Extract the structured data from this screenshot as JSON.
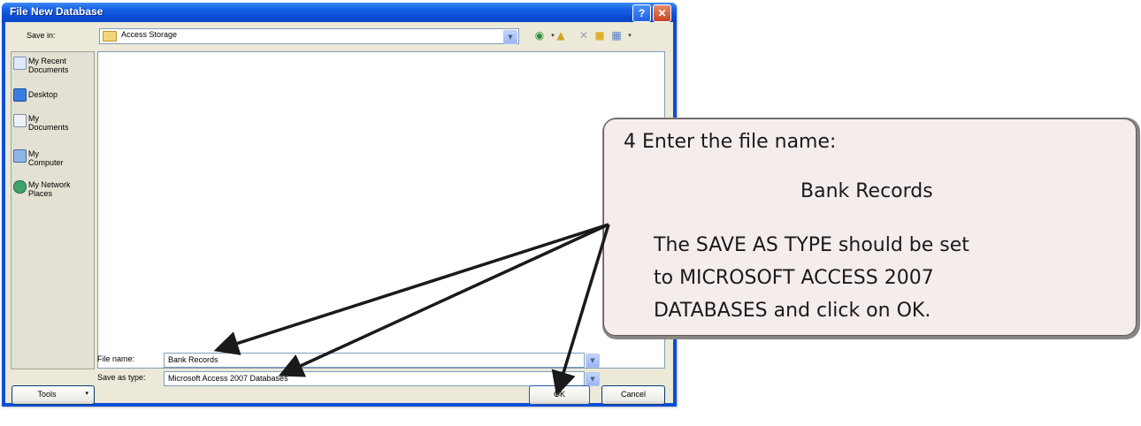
{
  "window": {
    "title": "File New Database",
    "help_glyph": "?",
    "close_glyph": "✕"
  },
  "savein": {
    "label": "Save in:",
    "value": "Access Storage"
  },
  "places": [
    {
      "label": "My Recent\nDocuments",
      "icon": "recent-documents-icon"
    },
    {
      "label": "Desktop",
      "icon": "desktop-icon"
    },
    {
      "label": "My\nDocuments",
      "icon": "my-documents-icon"
    },
    {
      "label": "My\nComputer",
      "icon": "my-computer-icon"
    },
    {
      "label": "My Network\nPlaces",
      "icon": "network-places-icon"
    }
  ],
  "filename": {
    "label": "File name:",
    "value": "Bank Records"
  },
  "savetype": {
    "label": "Save as type:",
    "value": "Microsoft Access 2007 Databases"
  },
  "buttons": {
    "tools": "Tools",
    "ok": "OK",
    "cancel": "Cancel"
  },
  "callout": {
    "step": "4  Enter the file name:",
    "name": "Bank Records",
    "body_line1": "The SAVE AS TYPE should be set",
    "body_line2": "to MICROSOFT ACCESS 2007",
    "body_line3": "DATABASES and click on OK."
  },
  "colors": {
    "titlebar": "#0a4ed6",
    "dialog_face": "#ece9d8",
    "callout_fill": "#f5ecec",
    "arrow": "#1a1a1a"
  }
}
